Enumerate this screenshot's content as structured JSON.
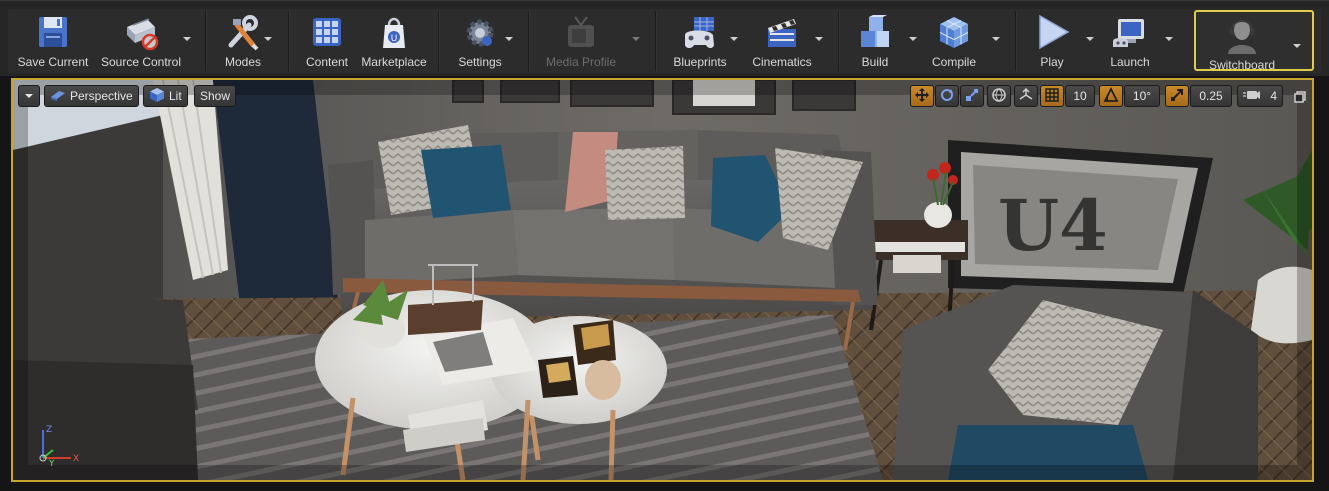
{
  "toolbar": {
    "save_current": "Save Current",
    "source_control": "Source Control",
    "modes": "Modes",
    "content": "Content",
    "marketplace": "Marketplace",
    "settings": "Settings",
    "media_profile": "Media Profile",
    "blueprints": "Blueprints",
    "cinematics": "Cinematics",
    "build": "Build",
    "compile": "Compile",
    "play": "Play",
    "launch": "Launch",
    "switchboard": "Switchboard"
  },
  "viewport": {
    "perspective": "Perspective",
    "lit": "Lit",
    "show": "Show",
    "grid_snap": "10",
    "rotation_snap": "10°",
    "scale_snap": "0.25",
    "camera_speed": "4",
    "overlay_text": "U4"
  },
  "axis": {
    "x": "X",
    "y": "Y",
    "z": "Z"
  },
  "colors": {
    "accent": "#c9a62b",
    "toolbar_bg": "#2c2c2c",
    "orange_toggle": "#c98a2a"
  },
  "icons": {
    "save": "floppy-disk-icon",
    "source_control": "source-control-icon",
    "modes": "modes-tools-icon",
    "content": "content-browser-icon",
    "marketplace": "marketplace-icon",
    "settings": "settings-icon",
    "media_profile": "media-profile-icon",
    "blueprints": "blueprints-gamepad-icon",
    "cinematics": "clapperboard-icon",
    "build": "build-blocks-icon",
    "compile": "compile-cube-icon",
    "play": "play-icon",
    "launch": "launch-icon",
    "switchboard": "switchboard-avatar-icon"
  }
}
